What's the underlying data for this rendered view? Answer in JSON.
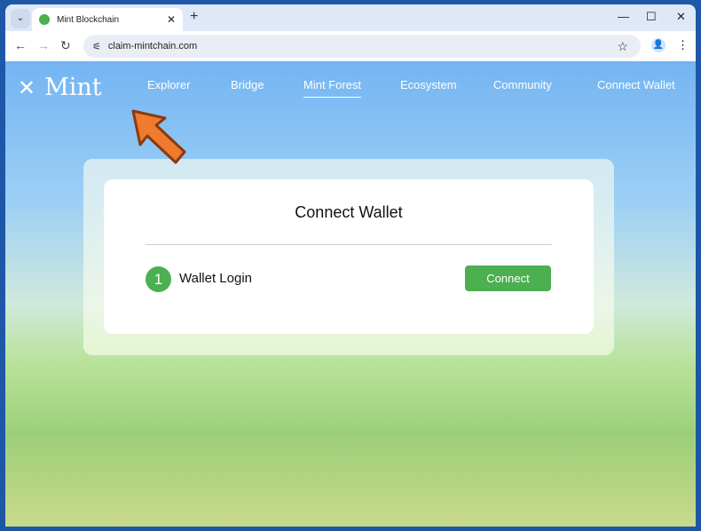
{
  "browser": {
    "tab_title": "Mint Blockchain",
    "url": "claim-mintchain.com",
    "new_tab": "+",
    "close": "✕"
  },
  "site": {
    "logo": "Mint",
    "nav": [
      "Explorer",
      "Bridge",
      "Mint Forest",
      "Ecosystem",
      "Community",
      "Connect Wallet"
    ],
    "active_nav": "Mint Forest"
  },
  "modal": {
    "title": "Connect Wallet",
    "step_number": "1",
    "step_label": "Wallet Login",
    "button": "Connect"
  },
  "colors": {
    "accent": "#4caf50"
  }
}
